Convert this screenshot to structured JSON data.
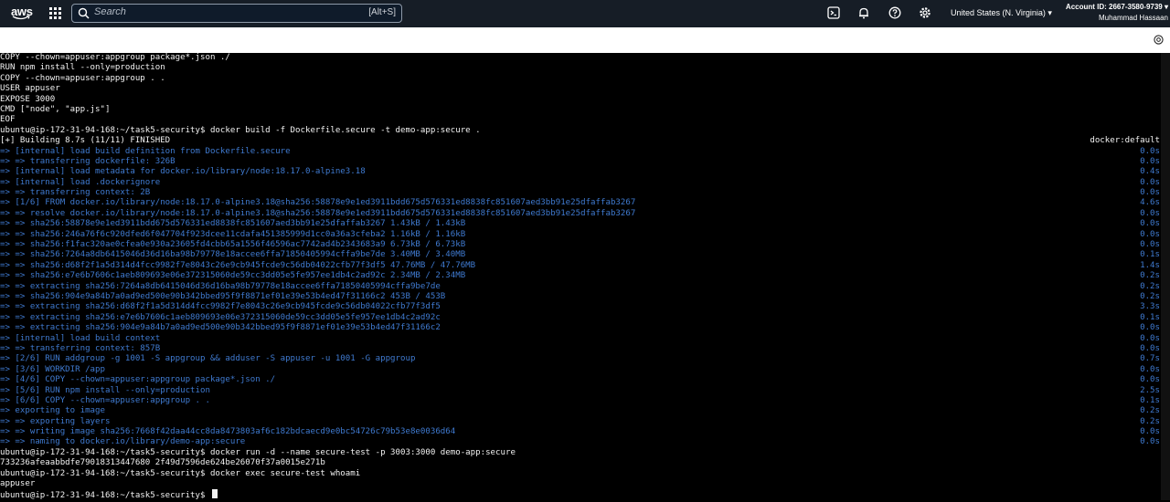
{
  "topbar": {
    "logo_text": "aws",
    "search": {
      "placeholder": "Search",
      "shortcut": "[Alt+S]"
    },
    "region": "United States (N. Virginia) ▾",
    "account_id": "Account ID: 2667-3580-9739 ▾",
    "user_name": "Muhammad Hassaan"
  },
  "icons": {
    "logo": "aws-logo",
    "apps": "grid-icon",
    "search": "search-icon",
    "cloudshell": "cloudshell-icon",
    "notifications": "bell-icon",
    "help": "help-icon",
    "settings": "gear-icon",
    "panel_settings": "settings-circle-icon"
  },
  "colors": {
    "topbar_bg": "#161d26",
    "terminal_bg": "#000000",
    "terminal_text": "#f2f2f2",
    "terminal_dim_text": "#3f7ad0"
  },
  "terminal": {
    "lines": [
      {
        "text": "COPY --chown=appuser:appgroup package*.json ./",
        "style": "w"
      },
      {
        "text": "RUN npm install --only=production",
        "style": "w"
      },
      {
        "text": "COPY --chown=appuser:appgroup . .",
        "style": "w"
      },
      {
        "text": "USER appuser",
        "style": "w"
      },
      {
        "text": "EXPOSE 3000",
        "style": "w"
      },
      {
        "text": "CMD [\"node\", \"app.js\"]",
        "style": "w"
      },
      {
        "text": "EOF",
        "style": "w"
      },
      {
        "text": "ubuntu@ip-172-31-94-168:~/task5-security$ docker build -f Dockerfile.secure -t demo-app:secure .",
        "style": "w"
      },
      {
        "text": "[+] Building 8.7s (11/11) FINISHED",
        "style": "w",
        "right": "docker:default"
      },
      {
        "text": "=> [internal] load build definition from Dockerfile.secure",
        "style": "b",
        "right": "0.0s"
      },
      {
        "text": "=> => transferring dockerfile: 326B",
        "style": "b",
        "right": "0.0s"
      },
      {
        "text": "=> [internal] load metadata for docker.io/library/node:18.17.0-alpine3.18",
        "style": "b",
        "right": "0.4s"
      },
      {
        "text": "=> [internal] load .dockerignore",
        "style": "b",
        "right": "0.0s"
      },
      {
        "text": "=> => transferring context: 2B",
        "style": "b",
        "right": "0.0s"
      },
      {
        "text": "=> [1/6] FROM docker.io/library/node:18.17.0-alpine3.18@sha256:58878e9e1ed3911bdd675d576331ed8838fc851607aed3bb91e25dfaffab3267",
        "style": "b",
        "right": "4.6s"
      },
      {
        "text": "=> => resolve docker.io/library/node:18.17.0-alpine3.18@sha256:58878e9e1ed3911bdd675d576331ed8838fc851607aed3bb91e25dfaffab3267",
        "style": "b",
        "right": "0.0s"
      },
      {
        "text": "=> => sha256:58878e9e1ed3911bdd675d576331ed8838fc851607aed3bb91e25dfaffab3267 1.43kB / 1.43kB",
        "style": "b",
        "right": "0.0s"
      },
      {
        "text": "=> => sha256:246a76f6c920dfed6f047704f923dcee11cdafa451385999d1cc0a36a3cfeba2 1.16kB / 1.16kB",
        "style": "b",
        "right": "0.0s"
      },
      {
        "text": "=> => sha256:f1fac320ae0cfea0e930a23605fd4cbb65a1556f46596ac7742ad4b2343683a9 6.73kB / 6.73kB",
        "style": "b",
        "right": "0.0s"
      },
      {
        "text": "=> => sha256:7264a8db6415046d36d16ba98b79778e18accee6ffa71850405994cffa9be7de 3.40MB / 3.40MB",
        "style": "b",
        "right": "0.1s"
      },
      {
        "text": "=> => sha256:d68f2f1a5d314d4fcc9982f7e8043c26e9cb945fcde9c56db04022cfb77f3df5 47.76MB / 47.76MB",
        "style": "b",
        "right": "1.4s"
      },
      {
        "text": "=> => sha256:e7e6b7606c1aeb809693e06e372315060de59cc3dd05e5fe957ee1db4c2ad92c 2.34MB / 2.34MB",
        "style": "b",
        "right": "0.2s"
      },
      {
        "text": "=> => extracting sha256:7264a8db6415046d36d16ba98b79778e18accee6ffa71850405994cffa9be7de",
        "style": "b",
        "right": "0.2s"
      },
      {
        "text": "=> => sha256:904e9a84b7a0ad9ed500e90b342bbed95f9f8871ef01e39e53b4ed47f31166c2 453B / 453B",
        "style": "b",
        "right": "0.2s"
      },
      {
        "text": "=> => extracting sha256:d68f2f1a5d314d4fcc9982f7e8043c26e9cb945fcde9c56db04022cfb77f3df5",
        "style": "b",
        "right": "3.3s"
      },
      {
        "text": "=> => extracting sha256:e7e6b7606c1aeb809693e06e372315060de59cc3dd05e5fe957ee1db4c2ad92c",
        "style": "b",
        "right": "0.1s"
      },
      {
        "text": "=> => extracting sha256:904e9a84b7a0ad9ed500e90b342bbed95f9f8871ef01e39e53b4ed47f31166c2",
        "style": "b",
        "right": "0.0s"
      },
      {
        "text": "=> [internal] load build context",
        "style": "b",
        "right": "0.0s"
      },
      {
        "text": "=> => transferring context: 857B",
        "style": "b",
        "right": "0.0s"
      },
      {
        "text": "=> [2/6] RUN addgroup -g 1001 -S appgroup && adduser -S appuser -u 1001 -G appgroup",
        "style": "b",
        "right": "0.7s"
      },
      {
        "text": "=> [3/6] WORKDIR /app",
        "style": "b",
        "right": "0.0s"
      },
      {
        "text": "=> [4/6] COPY --chown=appuser:appgroup package*.json ./",
        "style": "b",
        "right": "0.0s"
      },
      {
        "text": "=> [5/6] RUN npm install --only=production",
        "style": "b",
        "right": "2.5s"
      },
      {
        "text": "=> [6/6] COPY --chown=appuser:appgroup . .",
        "style": "b",
        "right": "0.1s"
      },
      {
        "text": "=> exporting to image",
        "style": "b",
        "right": "0.2s"
      },
      {
        "text": "=> => exporting layers",
        "style": "b",
        "right": "0.2s"
      },
      {
        "text": "=> => writing image sha256:7668f42daa44cc8da8473803af6c182bdcaecd9e0bc54726c79b53e8e0036d64",
        "style": "b",
        "right": "0.0s"
      },
      {
        "text": "=> => naming to docker.io/library/demo-app:secure",
        "style": "b",
        "right": "0.0s"
      },
      {
        "text": "ubuntu@ip-172-31-94-168:~/task5-security$ docker run -d --name secure-test -p 3003:3000 demo-app:secure",
        "style": "w"
      },
      {
        "text": "733236afeaabbdfe79018313447680 2f49d7596de624be26070f37a0015e271b",
        "style": "w"
      },
      {
        "text": "ubuntu@ip-172-31-94-168:~/task5-security$ docker exec secure-test whoami",
        "style": "w"
      },
      {
        "text": "appuser",
        "style": "w"
      },
      {
        "text": "ubuntu@ip-172-31-94-168:~/task5-security$ ",
        "style": "w",
        "cursor": true
      }
    ]
  }
}
